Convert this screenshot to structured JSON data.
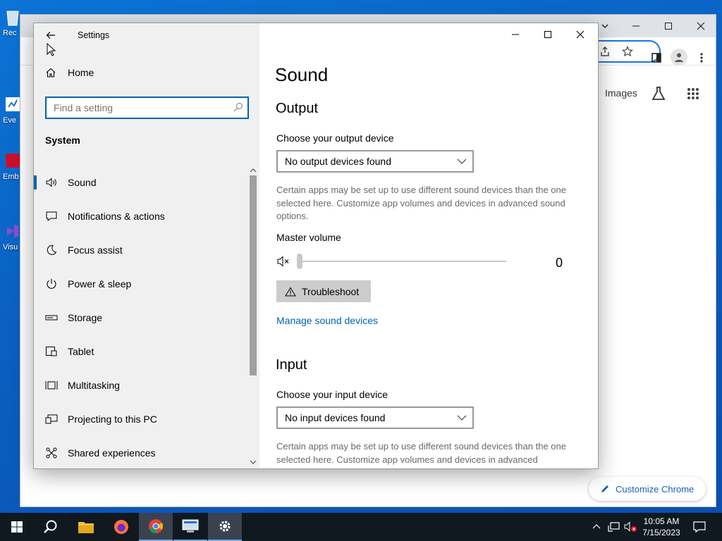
{
  "desktop": {
    "icons": [
      {
        "label": "Rec",
        "name": "recycle-bin"
      },
      {
        "label": "Eve",
        "name": "event-viewer"
      },
      {
        "label": "Emb De",
        "name": "embedded-device"
      },
      {
        "label": "Visu",
        "name": "visual-studio"
      }
    ]
  },
  "chrome": {
    "images_link": "Images",
    "customize_label": "Customize Chrome"
  },
  "settings": {
    "title": "Settings",
    "nav": {
      "home_label": "Home",
      "search_placeholder": "Find a setting",
      "section_label": "System",
      "items": [
        {
          "label": "Sound",
          "icon": "speaker-icon",
          "active": true
        },
        {
          "label": "Notifications & actions",
          "icon": "notification-icon"
        },
        {
          "label": "Focus assist",
          "icon": "moon-icon"
        },
        {
          "label": "Power & sleep",
          "icon": "power-icon"
        },
        {
          "label": "Storage",
          "icon": "storage-icon"
        },
        {
          "label": "Tablet",
          "icon": "tablet-icon"
        },
        {
          "label": "Multitasking",
          "icon": "multitasking-icon"
        },
        {
          "label": "Projecting to this PC",
          "icon": "projecting-icon"
        },
        {
          "label": "Shared experiences",
          "icon": "shared-experiences-icon"
        }
      ]
    },
    "content": {
      "page_title": "Sound",
      "output": {
        "heading": "Output",
        "device_label": "Choose your output device",
        "device_value": "No output devices found",
        "description": "Certain apps may be set up to use different sound devices than the one selected here. Customize app volumes and devices in advanced sound options.",
        "volume_label": "Master volume",
        "volume_value": "0",
        "troubleshoot_label": "Troubleshoot",
        "manage_link": "Manage sound devices"
      },
      "input": {
        "heading": "Input",
        "device_label": "Choose your input device",
        "device_value": "No input devices found",
        "description": "Certain apps may be set up to use different sound devices than the one selected here. Customize app volumes and devices in advanced"
      }
    }
  },
  "taskbar": {
    "time": "10:05 AM",
    "date": "7/15/2023"
  },
  "colors": {
    "accent": "#0063b1",
    "desktop": "#0a64c8",
    "taskbar": "#101820"
  }
}
